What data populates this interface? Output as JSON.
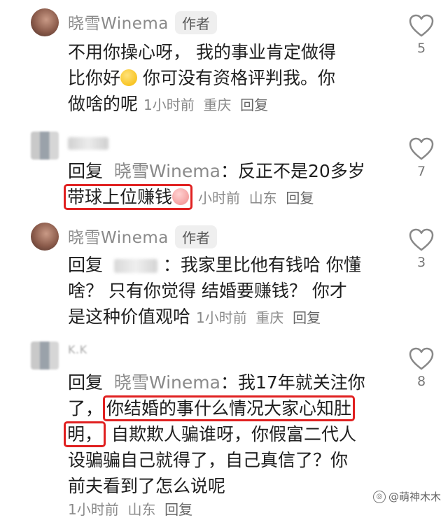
{
  "comments": [
    {
      "username": "晓雪Winema",
      "badge": "作者",
      "lines": [
        "不用你操心呀， 我的事业肯定做得",
        "比你好",
        " 你可没有资格评判我。你",
        "做啥的呢"
      ],
      "time": "1小时前",
      "location": "重庆",
      "reply_label": "回复",
      "likes": "5"
    },
    {
      "reply_prefix": "回复",
      "reply_to": "晓雪Winema",
      "line1_rest": "：反正不是20多岁",
      "highlight": "带球上位赚钱",
      "time": "小时前",
      "location": "山东",
      "reply_label": "回复",
      "likes": "7"
    },
    {
      "username": "晓雪Winema",
      "badge": "作者",
      "reply_prefix": "回复",
      "line1_rest": "：我家里比他有钱哈 你懂",
      "line2": "啥？ 只有你觉得 结婚要赚钱？ 你才",
      "line3": "是这种价值观哈",
      "time": "1小时前",
      "location": "重庆",
      "reply_label": "回复",
      "likes": "3"
    },
    {
      "username_partial": "K.K",
      "reply_prefix": "回复",
      "reply_to": "晓雪Winema",
      "line1_rest": "：我17年就关注你",
      "line2_pre": "了，",
      "highlight_a": "你结婚的事什么情况大家心知肚",
      "highlight_b": "明，",
      "line3_rest": "自欺欺人骗谁呀，你假富二代人",
      "line4": "设骗骗自己就得了，自己真信了？你",
      "line5": "前夫看到了怎么说呢",
      "time": "1小时前",
      "location": "山东",
      "reply_label": "回复",
      "likes": "8"
    }
  ],
  "watermark": "@萌神木木",
  "icons": {
    "like": "heart-outline-icon"
  }
}
